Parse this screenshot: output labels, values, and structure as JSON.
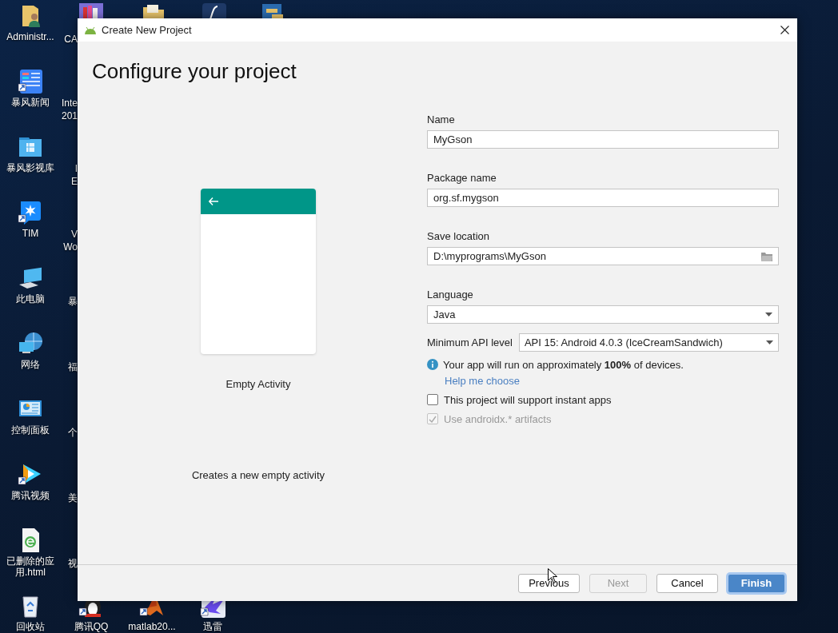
{
  "desktop": {
    "icons": [
      {
        "label": "Administr...",
        "kind": "user-folder"
      },
      {
        "label": "暴风新闻",
        "kind": "news"
      },
      {
        "label": "暴风影视库",
        "kind": "video-folder"
      },
      {
        "label": "TIM",
        "kind": "tim"
      },
      {
        "label": "此电脑",
        "kind": "computer"
      },
      {
        "label": "网络",
        "kind": "network"
      },
      {
        "label": "控制面板",
        "kind": "control-panel"
      },
      {
        "label": "腾讯视频",
        "kind": "video-player"
      },
      {
        "label": "已删除的应用.html",
        "kind": "html-file"
      },
      {
        "label": "回收站",
        "kind": "recycle-bin"
      }
    ],
    "cut_labels": [
      "CA",
      "Inte\n201",
      "I\nE",
      "V\nWo",
      "暴",
      "福",
      "个",
      "美",
      "视"
    ],
    "top_icons": [
      {
        "kind": "books"
      },
      {
        "kind": "folder"
      },
      {
        "kind": "pen"
      },
      {
        "kind": "app"
      }
    ],
    "bottom_icons": [
      {
        "label": "腾讯QQ",
        "kind": "penguin"
      },
      {
        "label": "matlab20...",
        "kind": "matlab"
      },
      {
        "label": "迅雷",
        "kind": "bird"
      }
    ]
  },
  "dialog": {
    "title": "Create New Project",
    "heading": "Configure your project",
    "template": {
      "name": "Empty Activity",
      "description": "Creates a new empty activity"
    },
    "fields": [
      {
        "label": "Name",
        "value": "MyGson",
        "kind": "text"
      },
      {
        "label": "Package name",
        "value": "org.sf.mygson",
        "kind": "text"
      },
      {
        "label": "Save location",
        "value": "D:\\myprograms\\MyGson",
        "kind": "folder"
      },
      {
        "label": "Language",
        "value": "Java",
        "kind": "dropdown"
      }
    ],
    "min_api": {
      "label": "Minimum API level",
      "value": "API 15: Android 4.0.3 (IceCreamSandwich)"
    },
    "info": "Your app will run on approximately **100%** of devices.",
    "help_link": "Help me choose",
    "options": [
      {
        "label": "This project will support instant apps",
        "checked": false,
        "disabled": false
      },
      {
        "label": "Use androidx.* artifacts",
        "checked": true,
        "disabled": true
      }
    ],
    "buttons": [
      {
        "label": "Previous",
        "disabled": false,
        "default": false
      },
      {
        "label": "Next",
        "disabled": true,
        "default": false
      },
      {
        "label": "Cancel",
        "disabled": false,
        "default": false
      },
      {
        "label": "Finish",
        "disabled": false,
        "default": true
      }
    ]
  }
}
